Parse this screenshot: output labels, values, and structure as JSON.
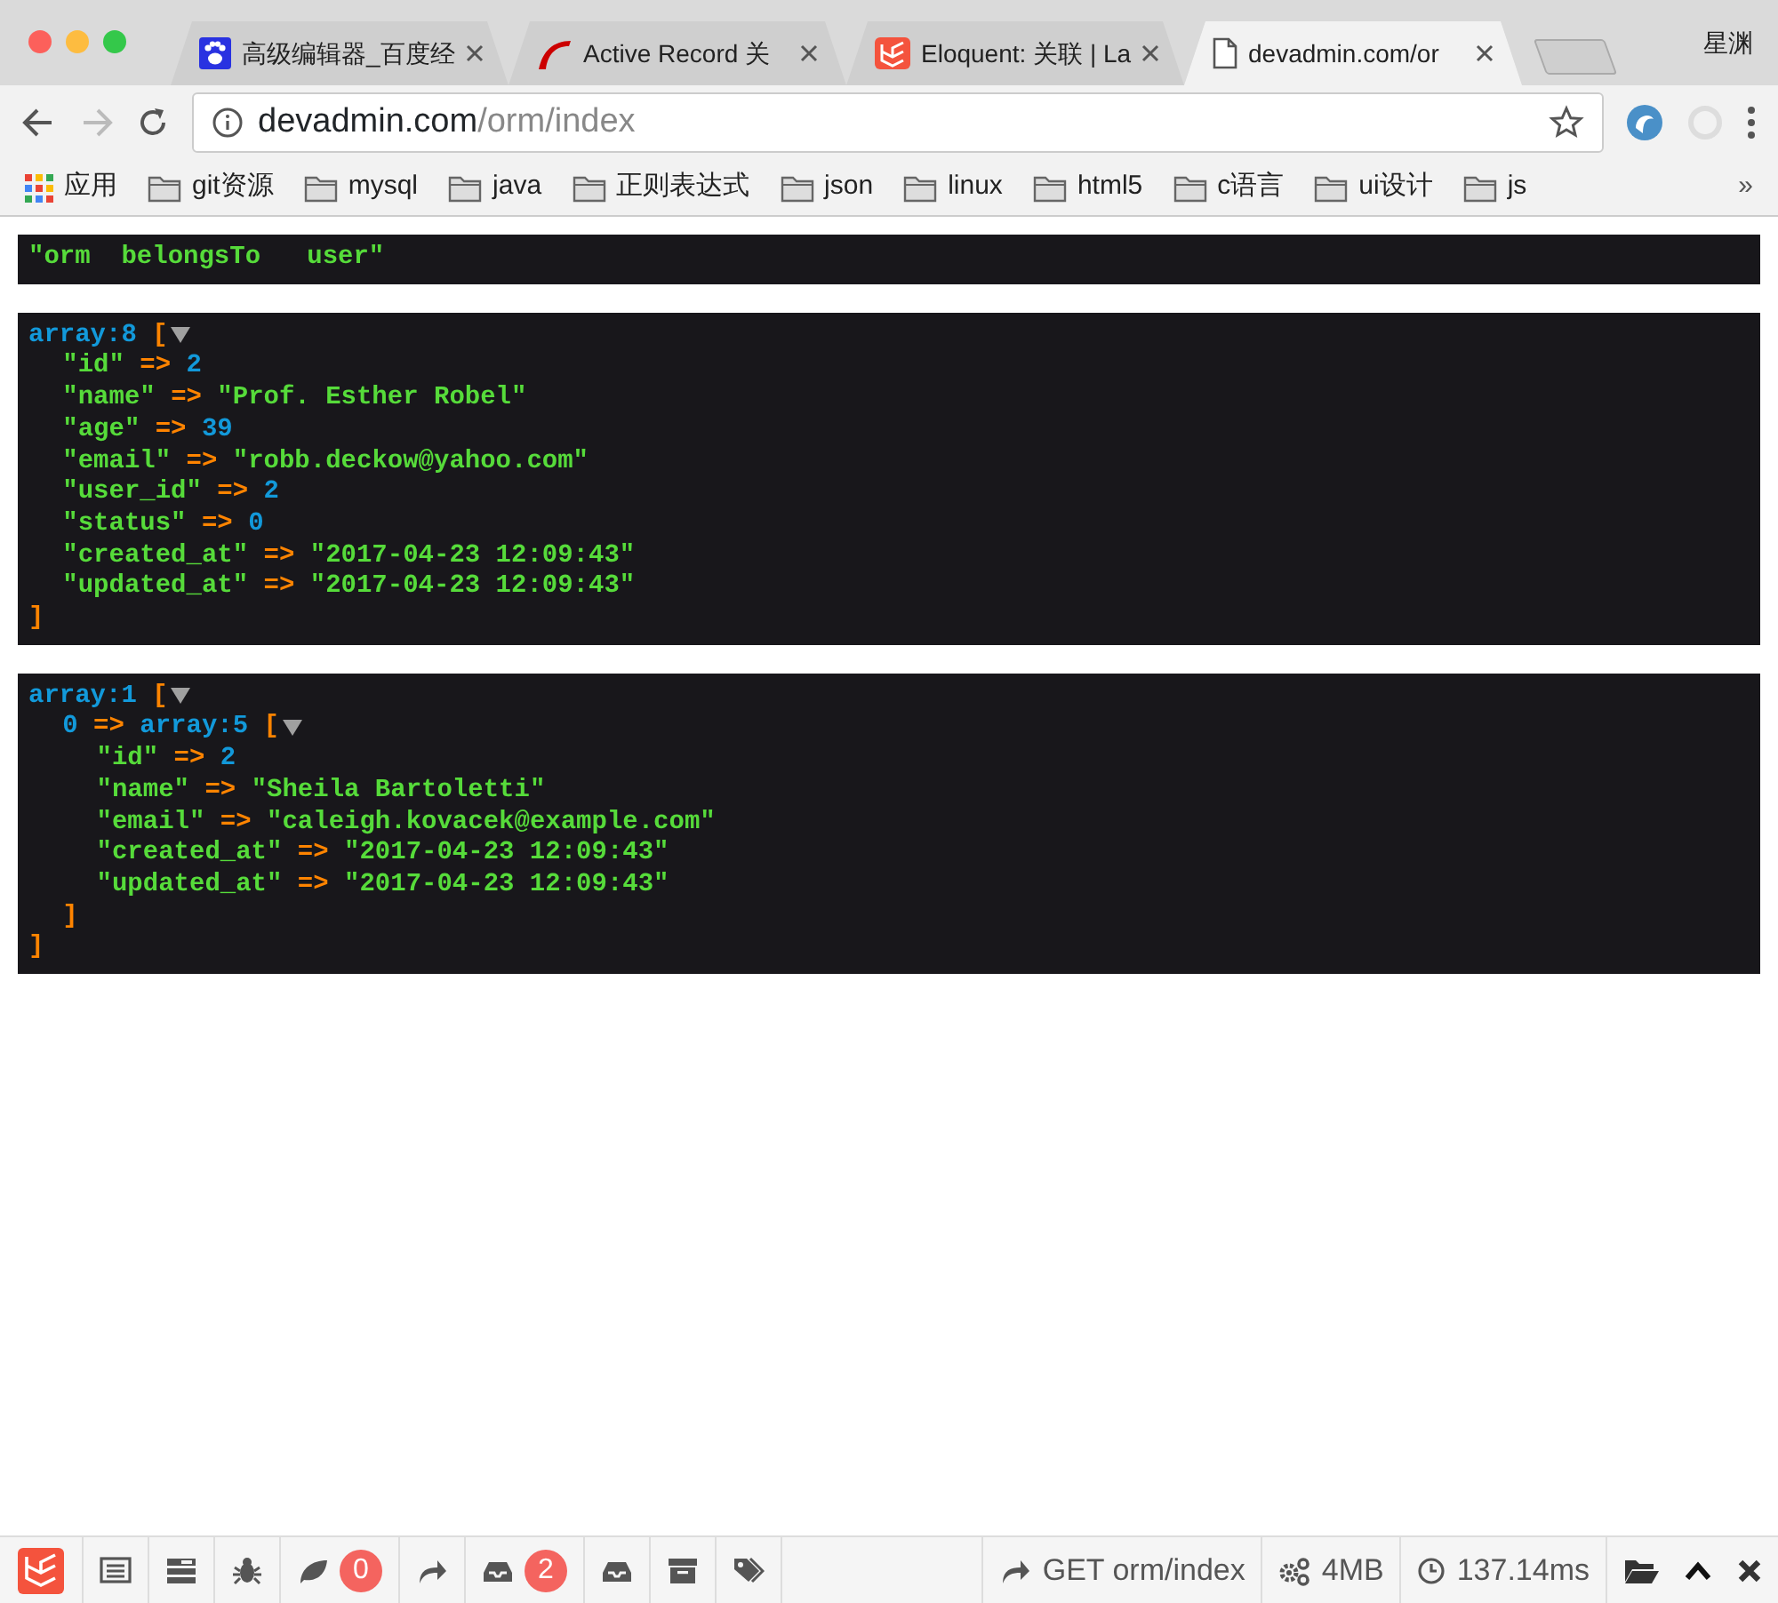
{
  "browser": {
    "tabs": [
      {
        "kind": "paw",
        "title": "高级编辑器_百度经",
        "selected": false
      },
      {
        "kind": "rails",
        "title": "Active Record 关",
        "selected": false
      },
      {
        "kind": "laravel",
        "title": "Eloquent: 关联 | La",
        "selected": false
      },
      {
        "kind": "page",
        "title": "devadmin.com/or",
        "selected": true
      }
    ],
    "profile": "星渊",
    "address": {
      "host": "devadmin.com",
      "path": "/orm/index"
    },
    "bookmarks": [
      {
        "kind": "apps",
        "label": "应用"
      },
      {
        "kind": "folder",
        "label": "git资源"
      },
      {
        "kind": "folder",
        "label": "mysql"
      },
      {
        "kind": "folder",
        "label": "java"
      },
      {
        "kind": "folder",
        "label": "正则表达式"
      },
      {
        "kind": "folder",
        "label": "json"
      },
      {
        "kind": "folder",
        "label": "linux"
      },
      {
        "kind": "folder",
        "label": "html5"
      },
      {
        "kind": "folder",
        "label": "c语言"
      },
      {
        "kind": "folder",
        "label": "ui设计"
      },
      {
        "kind": "folder",
        "label": "js"
      }
    ],
    "bookmarks_more": "»"
  },
  "dumps": [
    {
      "kind": "string",
      "text": "\"orm  belongsTo   user\""
    },
    {
      "kind": "array",
      "header": "array:8",
      "open": "[",
      "expanded": true,
      "close": "]",
      "entries": [
        {
          "key": "\"id\"",
          "arrow": "=>",
          "kind": "number",
          "value": "2"
        },
        {
          "key": "\"name\"",
          "arrow": "=>",
          "kind": "string",
          "value": "\"Prof. Esther Robel\""
        },
        {
          "key": "\"age\"",
          "arrow": "=>",
          "kind": "number",
          "value": "39"
        },
        {
          "key": "\"email\"",
          "arrow": "=>",
          "kind": "string",
          "value": "\"robb.deckow@yahoo.com\""
        },
        {
          "key": "\"user_id\"",
          "arrow": "=>",
          "kind": "number",
          "value": "2"
        },
        {
          "key": "\"status\"",
          "arrow": "=>",
          "kind": "number",
          "value": "0"
        },
        {
          "key": "\"created_at\"",
          "arrow": "=>",
          "kind": "string",
          "value": "\"2017-04-23 12:09:43\""
        },
        {
          "key": "\"updated_at\"",
          "arrow": "=>",
          "kind": "string",
          "value": "\"2017-04-23 12:09:43\""
        }
      ]
    },
    {
      "kind": "array",
      "header": "array:1",
      "open": "[",
      "expanded": true,
      "close": "]",
      "entries": [
        {
          "key": "0",
          "arrow": "=>",
          "kind": "array",
          "header": "array:5",
          "open": "[",
          "expanded": true,
          "close": "]",
          "entries": [
            {
              "key": "\"id\"",
              "arrow": "=>",
              "kind": "number",
              "value": "2"
            },
            {
              "key": "\"name\"",
              "arrow": "=>",
              "kind": "string",
              "value": "\"Sheila Bartoletti\""
            },
            {
              "key": "\"email\"",
              "arrow": "=>",
              "kind": "string",
              "value": "\"caleigh.kovacek@example.com\""
            },
            {
              "key": "\"created_at\"",
              "arrow": "=>",
              "kind": "string",
              "value": "\"2017-04-23 12:09:43\""
            },
            {
              "key": "\"updated_at\"",
              "arrow": "=>",
              "kind": "string",
              "value": "\"2017-04-23 12:09:43\""
            }
          ]
        }
      ]
    }
  ],
  "debugbar": {
    "tabs": [
      {
        "kind": "messages"
      },
      {
        "kind": "timeline"
      },
      {
        "kind": "exceptions"
      },
      {
        "kind": "views",
        "badge": "0"
      },
      {
        "kind": "route"
      },
      {
        "kind": "queries",
        "badge": "2"
      },
      {
        "kind": "mails"
      },
      {
        "kind": "gate"
      },
      {
        "kind": "tags"
      }
    ],
    "route": "GET orm/index",
    "memory": "4MB",
    "time": "137.14ms"
  }
}
